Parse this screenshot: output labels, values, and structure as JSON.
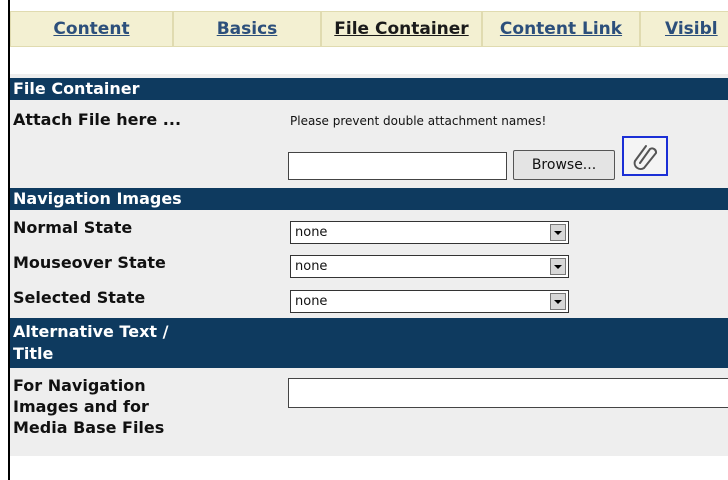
{
  "tabs": [
    {
      "label": "Content",
      "active": false
    },
    {
      "label": "Basics",
      "active": false
    },
    {
      "label": "File Container",
      "active": true
    },
    {
      "label": "Content Link",
      "active": false
    },
    {
      "label": "Visibl",
      "active": false
    }
  ],
  "file_container": {
    "header": "File Container",
    "attach_label": "Attach File here ...",
    "hint": "Please prevent double attachment names!",
    "file_value": "",
    "browse_label": "Browse...",
    "attach_icon": "paperclip-icon"
  },
  "navigation_images": {
    "header": "Navigation Images",
    "rows": [
      {
        "label": "Normal State",
        "value": "none"
      },
      {
        "label": "Mouseover State",
        "value": "none"
      },
      {
        "label": "Selected State",
        "value": "none"
      }
    ]
  },
  "alternative_text": {
    "header_line1": "Alternative Text /",
    "header_line2": "Title",
    "label_line1": "For Navigation",
    "label_line2": "Images and for",
    "label_line3": "Media Base Files",
    "value": ""
  },
  "colors": {
    "header_bg": "#0e3a5f",
    "tab_bg": "#f3f0d2",
    "tab_text": "#2c4f7b",
    "attach_border": "#1b2fd6"
  }
}
